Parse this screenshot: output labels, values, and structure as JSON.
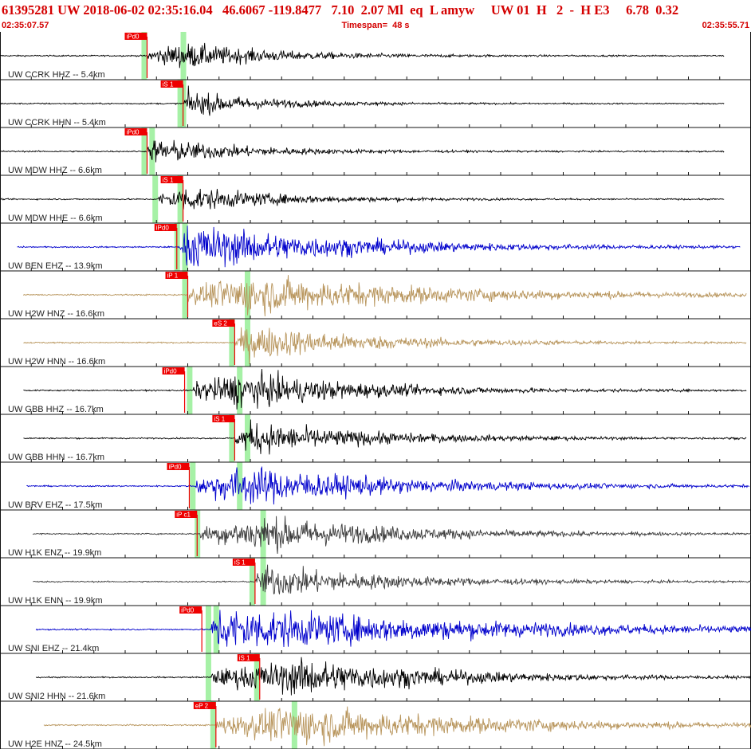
{
  "header": {
    "title": "61395281 UW 2018-06-02 02:35:16.04   46.6067 -119.8477   7.10  2.07 Ml  eq  L amyw     UW 01  H   2  -  H E3     6.78  0.32",
    "start_time": "02:35:07.57",
    "timespan": "Timespan=  48 s",
    "end_time": "02:35:55.71"
  },
  "colors": {
    "header_text": "#d40000",
    "pick_flag": "#ee0000",
    "window_band": "#9cf09c",
    "divider": "#111111",
    "trace_black": "#000000",
    "trace_blue": "#0000cc",
    "trace_tan": "#b8955c",
    "trace_gray": "#3c3c3c"
  },
  "chart_data": {
    "type": "line",
    "title": "61395281 UW 2018-06-02 02:35:16.04   46.6067 -119.8477   7.10  2.07 Ml  eq  L amyw     UW 01  H   2  -  H E3     6.78  0.32",
    "xlabel": "",
    "ylabel": "",
    "x_range": [
      "02:35:07.57",
      "02:35:55.71"
    ],
    "timespan_s": 48,
    "grid": "tick marks on row dividers",
    "traces": [
      {
        "label": "UW CCRK HHZ -- 5.4km",
        "color": "black",
        "data_start_s": 0,
        "data_end_s": 46.3,
        "onset_s": 9.4,
        "peak_s": 11.9,
        "amp": 0.55,
        "decay_s": 6,
        "pick": {
          "label": "iPd0",
          "t_s": 9.4
        }
      },
      {
        "label": "UW CCRK HHN -- 5.4km",
        "color": "black",
        "data_start_s": 0,
        "data_end_s": 46.3,
        "onset_s": 11.7,
        "peak_s": 11.9,
        "amp": 0.55,
        "decay_s": 5,
        "pick": {
          "label": "iS 1",
          "t_s": 11.7
        }
      },
      {
        "label": "UW MDW HHZ -- 6.6km",
        "color": "black",
        "data_start_s": 0,
        "data_end_s": 46.3,
        "onset_s": 9.4,
        "peak_s": 9.9,
        "amp": 0.55,
        "decay_s": 6,
        "pick": {
          "label": "iPd0",
          "t_s": 9.4
        }
      },
      {
        "label": "UW MDW HHE -- 6.6km",
        "color": "black",
        "data_start_s": 0,
        "data_end_s": 46.3,
        "onset_s": 10.1,
        "peak_s": 11.9,
        "amp": 0.55,
        "decay_s": 6,
        "pick": {
          "label": "iS 1",
          "t_s": 11.7
        }
      },
      {
        "label": "UW BEN EHZ -- 13.9km",
        "color": "blue",
        "data_start_s": 1.1,
        "data_end_s": 47.3,
        "onset_s": 11.5,
        "peak_s": 12.0,
        "amp": 1.0,
        "decay_s": 10,
        "pick": {
          "label": "iPd0",
          "t_s": 11.3
        }
      },
      {
        "label": "UW H2W HNZ -- 16.6km",
        "color": "tan",
        "data_start_s": 1.5,
        "data_end_s": 47.7,
        "onset_s": 12.0,
        "peak_s": 16.0,
        "amp": 0.85,
        "decay_s": 12,
        "pick": {
          "label": "iP 1",
          "t_s": 12.0
        }
      },
      {
        "label": "UW H2W HNN -- 16.6km",
        "color": "tan",
        "data_start_s": 1.5,
        "data_end_s": 47.7,
        "onset_s": 15.0,
        "peak_s": 16.0,
        "amp": 0.75,
        "decay_s": 8,
        "pick": {
          "label": "eS 2",
          "t_s": 15.0
        }
      },
      {
        "label": "UW GBB HHZ -- 16.7km",
        "color": "black",
        "data_start_s": 1.5,
        "data_end_s": 47.7,
        "onset_s": 12.3,
        "peak_s": 15.5,
        "amp": 0.8,
        "decay_s": 8,
        "pick": {
          "label": "iPd0",
          "t_s": 11.8
        }
      },
      {
        "label": "UW GBB HHN -- 16.7km",
        "color": "black",
        "data_start_s": 1.5,
        "data_end_s": 47.7,
        "onset_s": 15.0,
        "peak_s": 16.0,
        "amp": 0.7,
        "decay_s": 8,
        "pick": {
          "label": "iS 1",
          "t_s": 15.0
        }
      },
      {
        "label": "UW BRV EHZ -- 17.5km",
        "color": "blue",
        "data_start_s": 1.7,
        "data_end_s": 47.9,
        "onset_s": 12.5,
        "peak_s": 15.5,
        "amp": 0.85,
        "decay_s": 10,
        "pick": {
          "label": "iPd0",
          "t_s": 12.1
        }
      },
      {
        "label": "UW H1K ENZ -- 19.9km",
        "color": "gray",
        "data_start_s": 2.1,
        "data_end_s": 48.3,
        "onset_s": 12.8,
        "peak_s": 17.0,
        "amp": 0.75,
        "decay_s": 9,
        "pick": {
          "label": "iP c1",
          "t_s": 12.6
        }
      },
      {
        "label": "UW H1K ENN -- 19.9km",
        "color": "gray",
        "data_start_s": 2.1,
        "data_end_s": 48.3,
        "onset_s": 16.3,
        "peak_s": 17.0,
        "amp": 0.7,
        "decay_s": 8,
        "pick": {
          "label": "iS 1",
          "t_s": 16.3
        }
      },
      {
        "label": "UW SNI EHZ -- 21.4km",
        "color": "blue",
        "data_start_s": 2.3,
        "data_end_s": 48.5,
        "onset_s": 13.5,
        "peak_s": 14.0,
        "amp": 1.0,
        "decay_s": 16,
        "pick": {
          "label": "iPd0",
          "t_s": 12.9
        }
      },
      {
        "label": "UW SNI2 HHN -- 21.6km",
        "color": "black",
        "data_start_s": 2.3,
        "data_end_s": 48.5,
        "onset_s": 13.5,
        "peak_s": 19.5,
        "amp": 0.8,
        "decay_s": 9,
        "pick": {
          "label": "iS 1",
          "t_s": 16.6
        }
      },
      {
        "label": "UW H2E HNZ -- 24.5km",
        "color": "tan",
        "data_start_s": 2.8,
        "data_end_s": 49.0,
        "onset_s": 13.8,
        "peak_s": 19.0,
        "amp": 0.85,
        "decay_s": 12,
        "pick": {
          "label": "eP 2",
          "t_s": 13.8
        }
      }
    ]
  }
}
